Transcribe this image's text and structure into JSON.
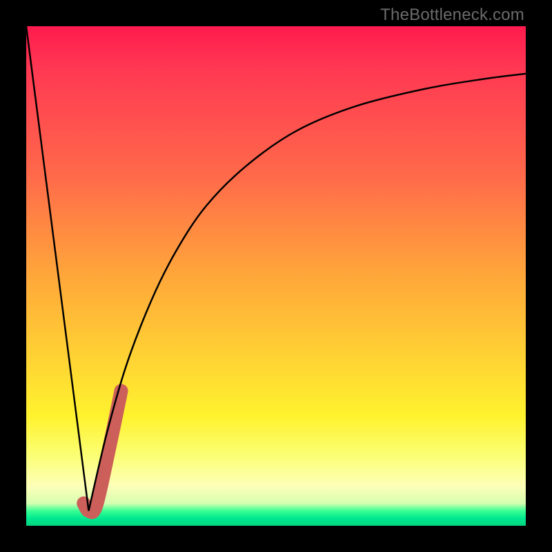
{
  "watermark": "TheBottleneck.com",
  "chart_data": {
    "type": "line",
    "title": "",
    "xlabel": "",
    "ylabel": "",
    "xlim": [
      0,
      100
    ],
    "ylim": [
      0,
      100
    ],
    "grid": false,
    "legend": false,
    "series": [
      {
        "name": "left-falling-line",
        "x": [
          0,
          12.5
        ],
        "y": [
          100,
          3
        ],
        "stroke": "#000000",
        "width": 2.5
      },
      {
        "name": "right-rising-curve",
        "x": [
          12.5,
          16,
          20,
          25,
          30,
          36,
          44,
          54,
          66,
          80,
          92,
          100
        ],
        "y": [
          3,
          18,
          32,
          45,
          55,
          64,
          72,
          79,
          84,
          87.5,
          89.5,
          90.5
        ],
        "stroke": "#000000",
        "width": 2.5
      },
      {
        "name": "highlight-j-stroke",
        "x": [
          11.5,
          12.5,
          14.0,
          16.5,
          19.0
        ],
        "y": [
          4.5,
          3.0,
          4.0,
          15.0,
          27.0
        ],
        "stroke": "#cc5f5a",
        "width": 20,
        "linecap": "round"
      }
    ],
    "gradient_stops": [
      {
        "pos": 0.0,
        "color": "#ff1a4d"
      },
      {
        "pos": 0.08,
        "color": "#ff3753"
      },
      {
        "pos": 0.3,
        "color": "#ff6a4a"
      },
      {
        "pos": 0.5,
        "color": "#ffa73a"
      },
      {
        "pos": 0.68,
        "color": "#ffd733"
      },
      {
        "pos": 0.78,
        "color": "#fff22e"
      },
      {
        "pos": 0.86,
        "color": "#fbff74"
      },
      {
        "pos": 0.92,
        "color": "#feffb8"
      },
      {
        "pos": 0.955,
        "color": "#d7ffb0"
      },
      {
        "pos": 0.97,
        "color": "#3bff94"
      },
      {
        "pos": 0.985,
        "color": "#00e890"
      },
      {
        "pos": 1.0,
        "color": "#00d67f"
      }
    ]
  }
}
